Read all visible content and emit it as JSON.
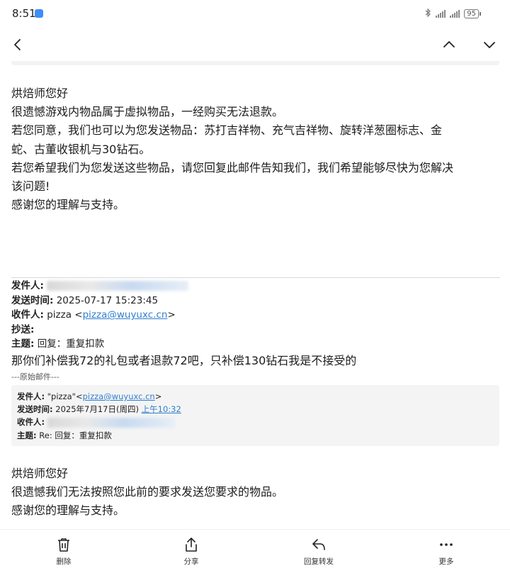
{
  "status_bar": {
    "time": "8:51",
    "battery": "95"
  },
  "icons": {
    "back": "chevron-left-icon",
    "prev": "chevron-up-icon",
    "next": "chevron-down-icon",
    "delete": "trash-icon",
    "share": "share-icon",
    "reply": "reply-icon",
    "more": "more-dots-icon"
  },
  "message_section_1": {
    "lines": [
      "烘焙师您好",
      "很遗憾游戏内物品属于虚拟物品，一经购买无法退款。",
      "若您同意，我们也可以为您发送物品：苏打吉祥物、充气吉祥物、旋转洋葱圈标志、金",
      "蛇、古董收银机与30钻石。",
      "若您希望我们为您发送这些物品，请您回复此邮件告知我们，我们希望能够尽快为您解决",
      "该问题!",
      "感谢您的理解与支持。"
    ]
  },
  "reply_header": {
    "from_label": "发件人:",
    "sent_label": "发送时间:",
    "sent_value": "2025-07-17 15:23:45",
    "to_label": "收件人:",
    "to_name": "pizza <",
    "to_email": "pizza@wuyuxc.cn",
    "to_close": ">",
    "cc_label": "抄送:",
    "subject_label": "主题:",
    "subject_value": "回复：重复扣款"
  },
  "reply_text": "那你们补偿我72的礼包或者退款72吧，只补偿130钻石我是不接受的",
  "original_divider": "---原始邮件---",
  "quoted_header": {
    "from_label": "发件人:",
    "from_name": "\"pizza\"<",
    "from_email": "pizza@wuyuxc.cn",
    "from_close": ">",
    "sent_label": "发送时间:",
    "sent_date": "2025年7月17日(周四) ",
    "sent_time": "上午10:32",
    "to_label": "收件人:",
    "subject_label": "主题:",
    "subject_value": "Re: 回复：重复扣款"
  },
  "message_section_3": {
    "lines": [
      "烘焙师您好",
      "很遗憾我们无法按照您此前的要求发送您要求的物品。",
      "感谢您的理解与支持。"
    ]
  },
  "bottom_bar": {
    "delete_label": "删除",
    "share_label": "分享",
    "reply_label": "回复转发",
    "more_label": "更多"
  }
}
